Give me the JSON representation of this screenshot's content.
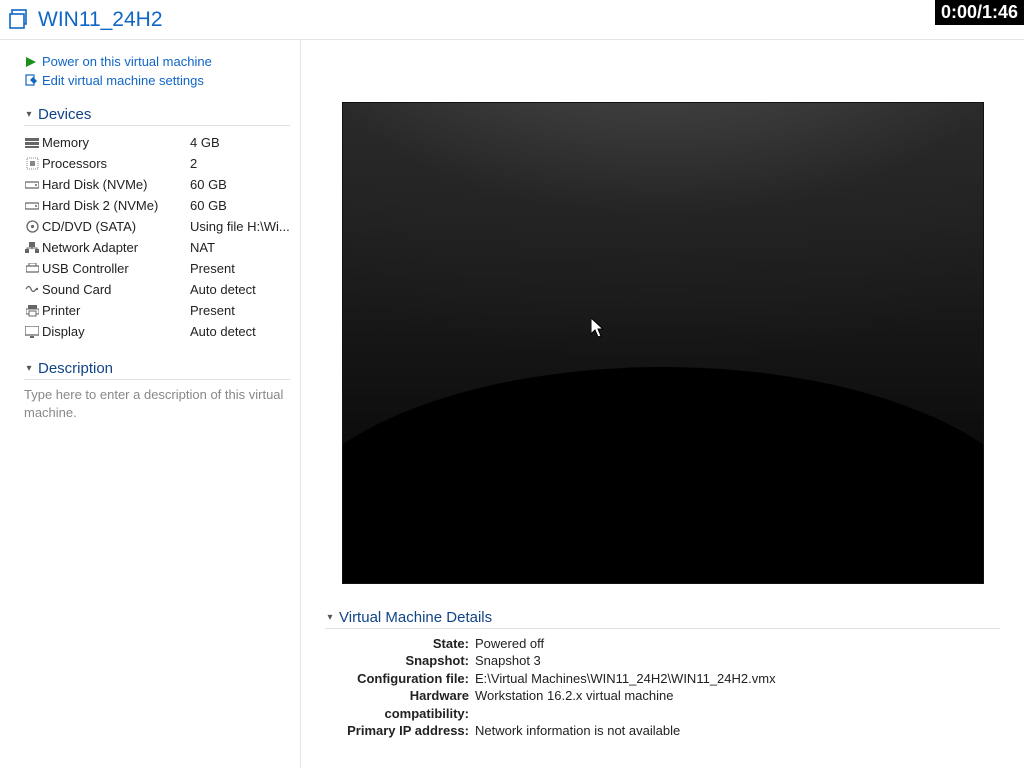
{
  "title": "WIN11_24H2",
  "timer": "0:00/1:46",
  "actions": {
    "power_on": "Power on this virtual machine",
    "edit_settings": "Edit virtual machine settings"
  },
  "sections": {
    "devices_label": "Devices",
    "description_label": "Description",
    "details_label": "Virtual Machine Details"
  },
  "devices": [
    {
      "label": "Memory",
      "value": "4 GB"
    },
    {
      "label": "Processors",
      "value": "2"
    },
    {
      "label": "Hard Disk (NVMe)",
      "value": "60 GB"
    },
    {
      "label": "Hard Disk 2 (NVMe)",
      "value": "60 GB"
    },
    {
      "label": "CD/DVD (SATA)",
      "value": "Using file H:\\Wi..."
    },
    {
      "label": "Network Adapter",
      "value": "NAT"
    },
    {
      "label": "USB Controller",
      "value": "Present"
    },
    {
      "label": "Sound Card",
      "value": "Auto detect"
    },
    {
      "label": "Printer",
      "value": "Present"
    },
    {
      "label": "Display",
      "value": "Auto detect"
    }
  ],
  "description_placeholder": "Type here to enter a description of this virtual machine.",
  "details": {
    "state": {
      "label": "State:",
      "value": "Powered off"
    },
    "snapshot": {
      "label": "Snapshot:",
      "value": "Snapshot 3"
    },
    "config": {
      "label": "Configuration file:",
      "value": "E:\\Virtual Machines\\WIN11_24H2\\WIN11_24H2.vmx"
    },
    "hwcompat": {
      "label": "Hardware compatibility:",
      "value": "Workstation 16.2.x virtual machine"
    },
    "ip": {
      "label": "Primary IP address:",
      "value": "Network information is not available"
    }
  }
}
